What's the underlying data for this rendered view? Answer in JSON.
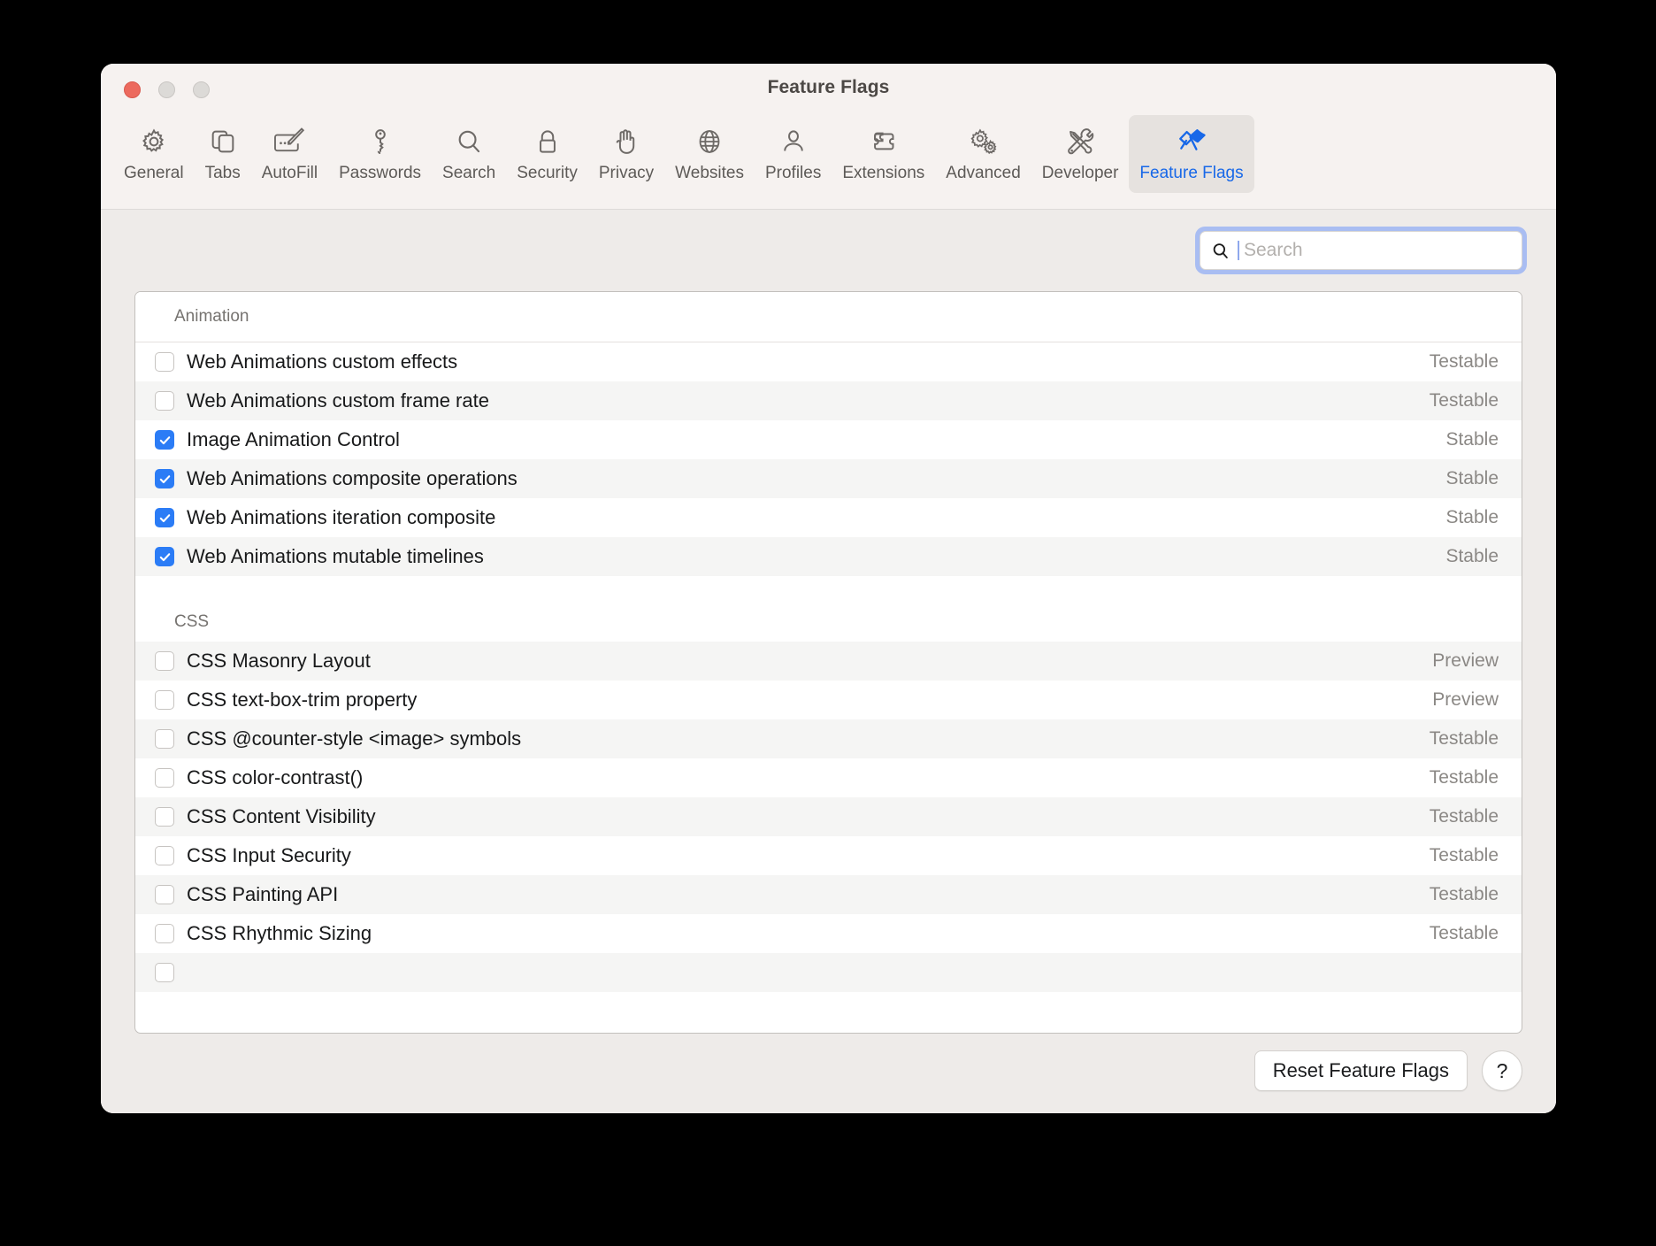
{
  "window": {
    "title": "Feature Flags",
    "traffic_lights": [
      "close",
      "minimize",
      "maximize"
    ]
  },
  "toolbar": {
    "items": [
      {
        "label": "General",
        "icon": "gear-icon",
        "selected": false
      },
      {
        "label": "Tabs",
        "icon": "tabs-icon",
        "selected": false
      },
      {
        "label": "AutoFill",
        "icon": "autofill-icon",
        "selected": false
      },
      {
        "label": "Passwords",
        "icon": "key-icon",
        "selected": false
      },
      {
        "label": "Search",
        "icon": "magnifier-icon",
        "selected": false
      },
      {
        "label": "Security",
        "icon": "lock-icon",
        "selected": false
      },
      {
        "label": "Privacy",
        "icon": "hand-icon",
        "selected": false
      },
      {
        "label": "Websites",
        "icon": "globe-icon",
        "selected": false
      },
      {
        "label": "Profiles",
        "icon": "person-icon",
        "selected": false
      },
      {
        "label": "Extensions",
        "icon": "puzzle-icon",
        "selected": false
      },
      {
        "label": "Advanced",
        "icon": "double-gear-icon",
        "selected": false
      },
      {
        "label": "Developer",
        "icon": "tools-icon",
        "selected": false
      },
      {
        "label": "Feature Flags",
        "icon": "flags-icon",
        "selected": true
      }
    ]
  },
  "search": {
    "placeholder": "Search",
    "value": "",
    "focused": true,
    "icon": "search-icon"
  },
  "sections": [
    {
      "title": "Animation",
      "rows": [
        {
          "name": "Web Animations custom effects",
          "checked": false,
          "status": "Testable"
        },
        {
          "name": "Web Animations custom frame rate",
          "checked": false,
          "status": "Testable"
        },
        {
          "name": "Image Animation Control",
          "checked": true,
          "status": "Stable"
        },
        {
          "name": "Web Animations composite operations",
          "checked": true,
          "status": "Stable"
        },
        {
          "name": "Web Animations iteration composite",
          "checked": true,
          "status": "Stable"
        },
        {
          "name": "Web Animations mutable timelines",
          "checked": true,
          "status": "Stable"
        }
      ]
    },
    {
      "title": "CSS",
      "rows": [
        {
          "name": "CSS Masonry Layout",
          "checked": false,
          "status": "Preview"
        },
        {
          "name": "CSS text-box-trim property",
          "checked": false,
          "status": "Preview"
        },
        {
          "name": "CSS @counter-style <image> symbols",
          "checked": false,
          "status": "Testable"
        },
        {
          "name": "CSS color-contrast()",
          "checked": false,
          "status": "Testable"
        },
        {
          "name": "CSS Content Visibility",
          "checked": false,
          "status": "Testable"
        },
        {
          "name": "CSS Input Security",
          "checked": false,
          "status": "Testable"
        },
        {
          "name": "CSS Painting API",
          "checked": false,
          "status": "Testable"
        },
        {
          "name": "CSS Rhythmic Sizing",
          "checked": false,
          "status": "Testable"
        }
      ]
    }
  ],
  "footer": {
    "reset_label": "Reset Feature Flags",
    "help_label": "?"
  },
  "colors": {
    "accent": "#1868e8",
    "checkbox_on": "#2b7cf6",
    "focus_ring": "#a9bdf2",
    "window_chrome": "#f6f2f0",
    "content_bg": "#eeebe9",
    "row_alt": "#f5f5f4"
  }
}
